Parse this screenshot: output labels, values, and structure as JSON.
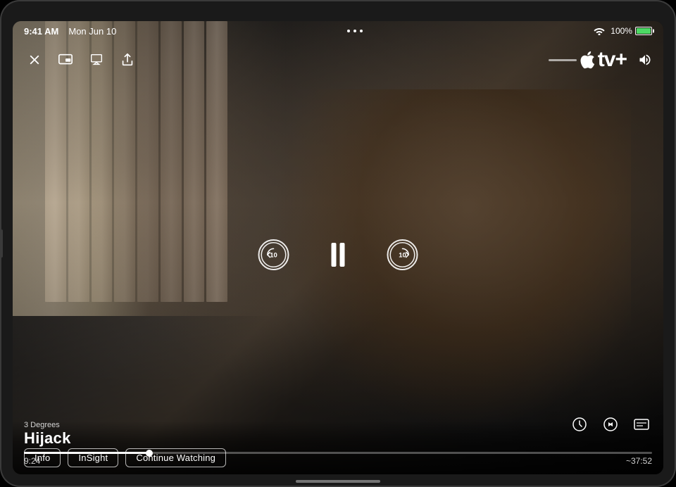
{
  "device": {
    "type": "iPad"
  },
  "statusBar": {
    "time": "9:41 AM",
    "date": "Mon Jun 10",
    "wifi": "WiFi",
    "battery_percent": "100%",
    "dots": [
      "•",
      "•",
      "•"
    ]
  },
  "topControls": {
    "close_label": "✕",
    "pip_label": "PiP",
    "airplay_label": "AirPlay",
    "share_label": "Share",
    "apple_tv_logo": "tv+",
    "volume_icon": "🔊"
  },
  "playback": {
    "rewind_seconds": "10",
    "forward_seconds": "10",
    "pause_label": "Pause"
  },
  "videoInfo": {
    "show_subtitle": "3 Degrees",
    "show_title": "Hijack",
    "current_time": "9:24",
    "remaining_time": "~37:52",
    "progress_percent": 20
  },
  "bottomRightControls": {
    "speed_label": "Speed",
    "audio_label": "Audio",
    "subtitles_label": "Subtitles"
  },
  "actionButtons": {
    "info_label": "Info",
    "insight_label": "InSight",
    "continue_watching_label": "Continue Watching"
  }
}
